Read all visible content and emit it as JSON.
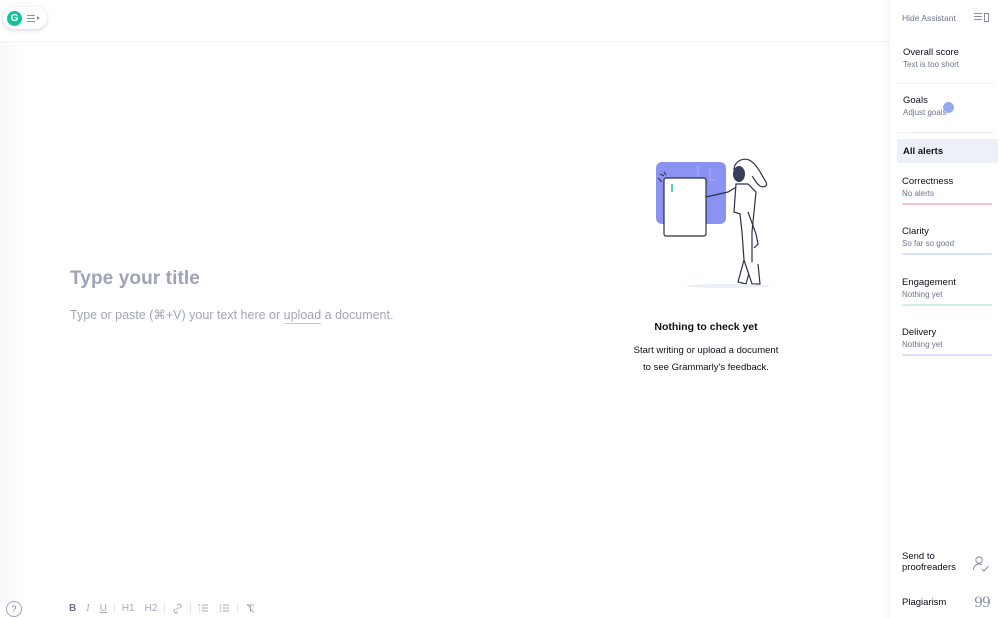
{
  "editor": {
    "title_placeholder": "Type your title",
    "body_placeholder_before": "Type or paste (⌘+V) your text here or ",
    "body_placeholder_link": "upload",
    "body_placeholder_after": " a document."
  },
  "grammarly_button": {
    "logo_letter": "G",
    "icon": "menu-icon"
  },
  "empty_state": {
    "title": "Nothing to check yet",
    "line1": "Start writing or upload a document",
    "line2": "to see Grammarly's feedback.",
    "accent_color": "#8a93f2"
  },
  "toolbar": {
    "help": "?",
    "bold": "B",
    "italic": "I",
    "underline": "U",
    "h1": "H1",
    "h2": "H2",
    "link": "🔗",
    "ordered_list": "≡",
    "bullet_list": "☰",
    "clear_format": "T̸"
  },
  "sidebar": {
    "hide_assistant": "Hide Assistant",
    "overall_score": {
      "label": "Overall score",
      "sub": "Text is too short"
    },
    "goals": {
      "label": "Goals",
      "sub": "Adjust goals"
    },
    "all_alerts": "All alerts",
    "categories": [
      {
        "label": "Correctness",
        "sub": "No alerts",
        "color": "#f6c3cb"
      },
      {
        "label": "Clarity",
        "sub": "So far so good",
        "color": "#d6e2f5"
      },
      {
        "label": "Engagement",
        "sub": "Nothing yet",
        "color": "#cdeee3"
      },
      {
        "label": "Delivery",
        "sub": "Nothing yet",
        "color": "#e0dcf7"
      }
    ],
    "send_to_proofreaders_line1": "Send to",
    "send_to_proofreaders_line2": "proofreaders",
    "plagiarism": "Plagiarism",
    "plagiarism_icon": "99"
  }
}
